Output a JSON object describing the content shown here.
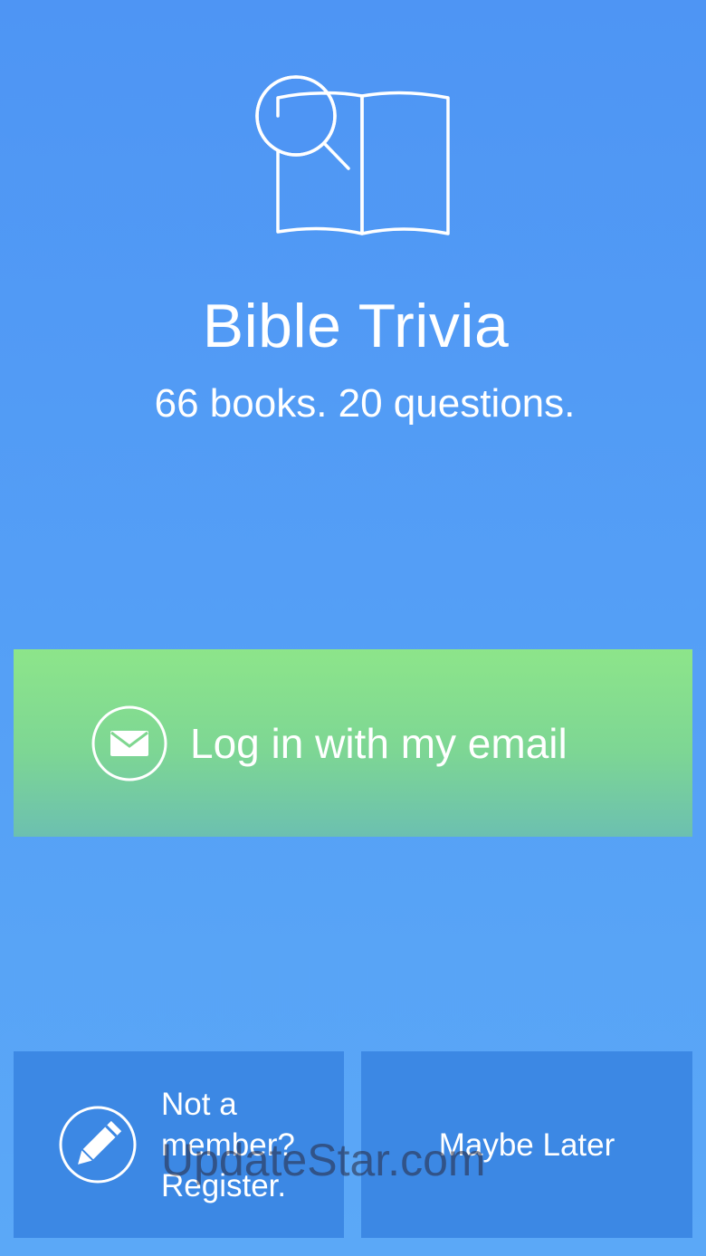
{
  "app": {
    "title": "Bible Trivia",
    "tagline": "66 books. 20 questions.",
    "logo_icon": "open-book-magnifier-icon"
  },
  "login": {
    "label": "Log in with my email",
    "icon": "envelope-icon"
  },
  "register": {
    "label": "Not a member? Register.",
    "icon": "pencil-icon"
  },
  "later": {
    "label": "Maybe Later"
  },
  "watermark": {
    "text": "UpdateStar.com"
  },
  "colors": {
    "background_top": "#4e95f4",
    "background_bottom": "#5ba8f7",
    "login_top": "#8de58a",
    "login_bottom": "#6cc0b0",
    "secondary_button": "#3c88e4",
    "text": "#ffffff"
  }
}
